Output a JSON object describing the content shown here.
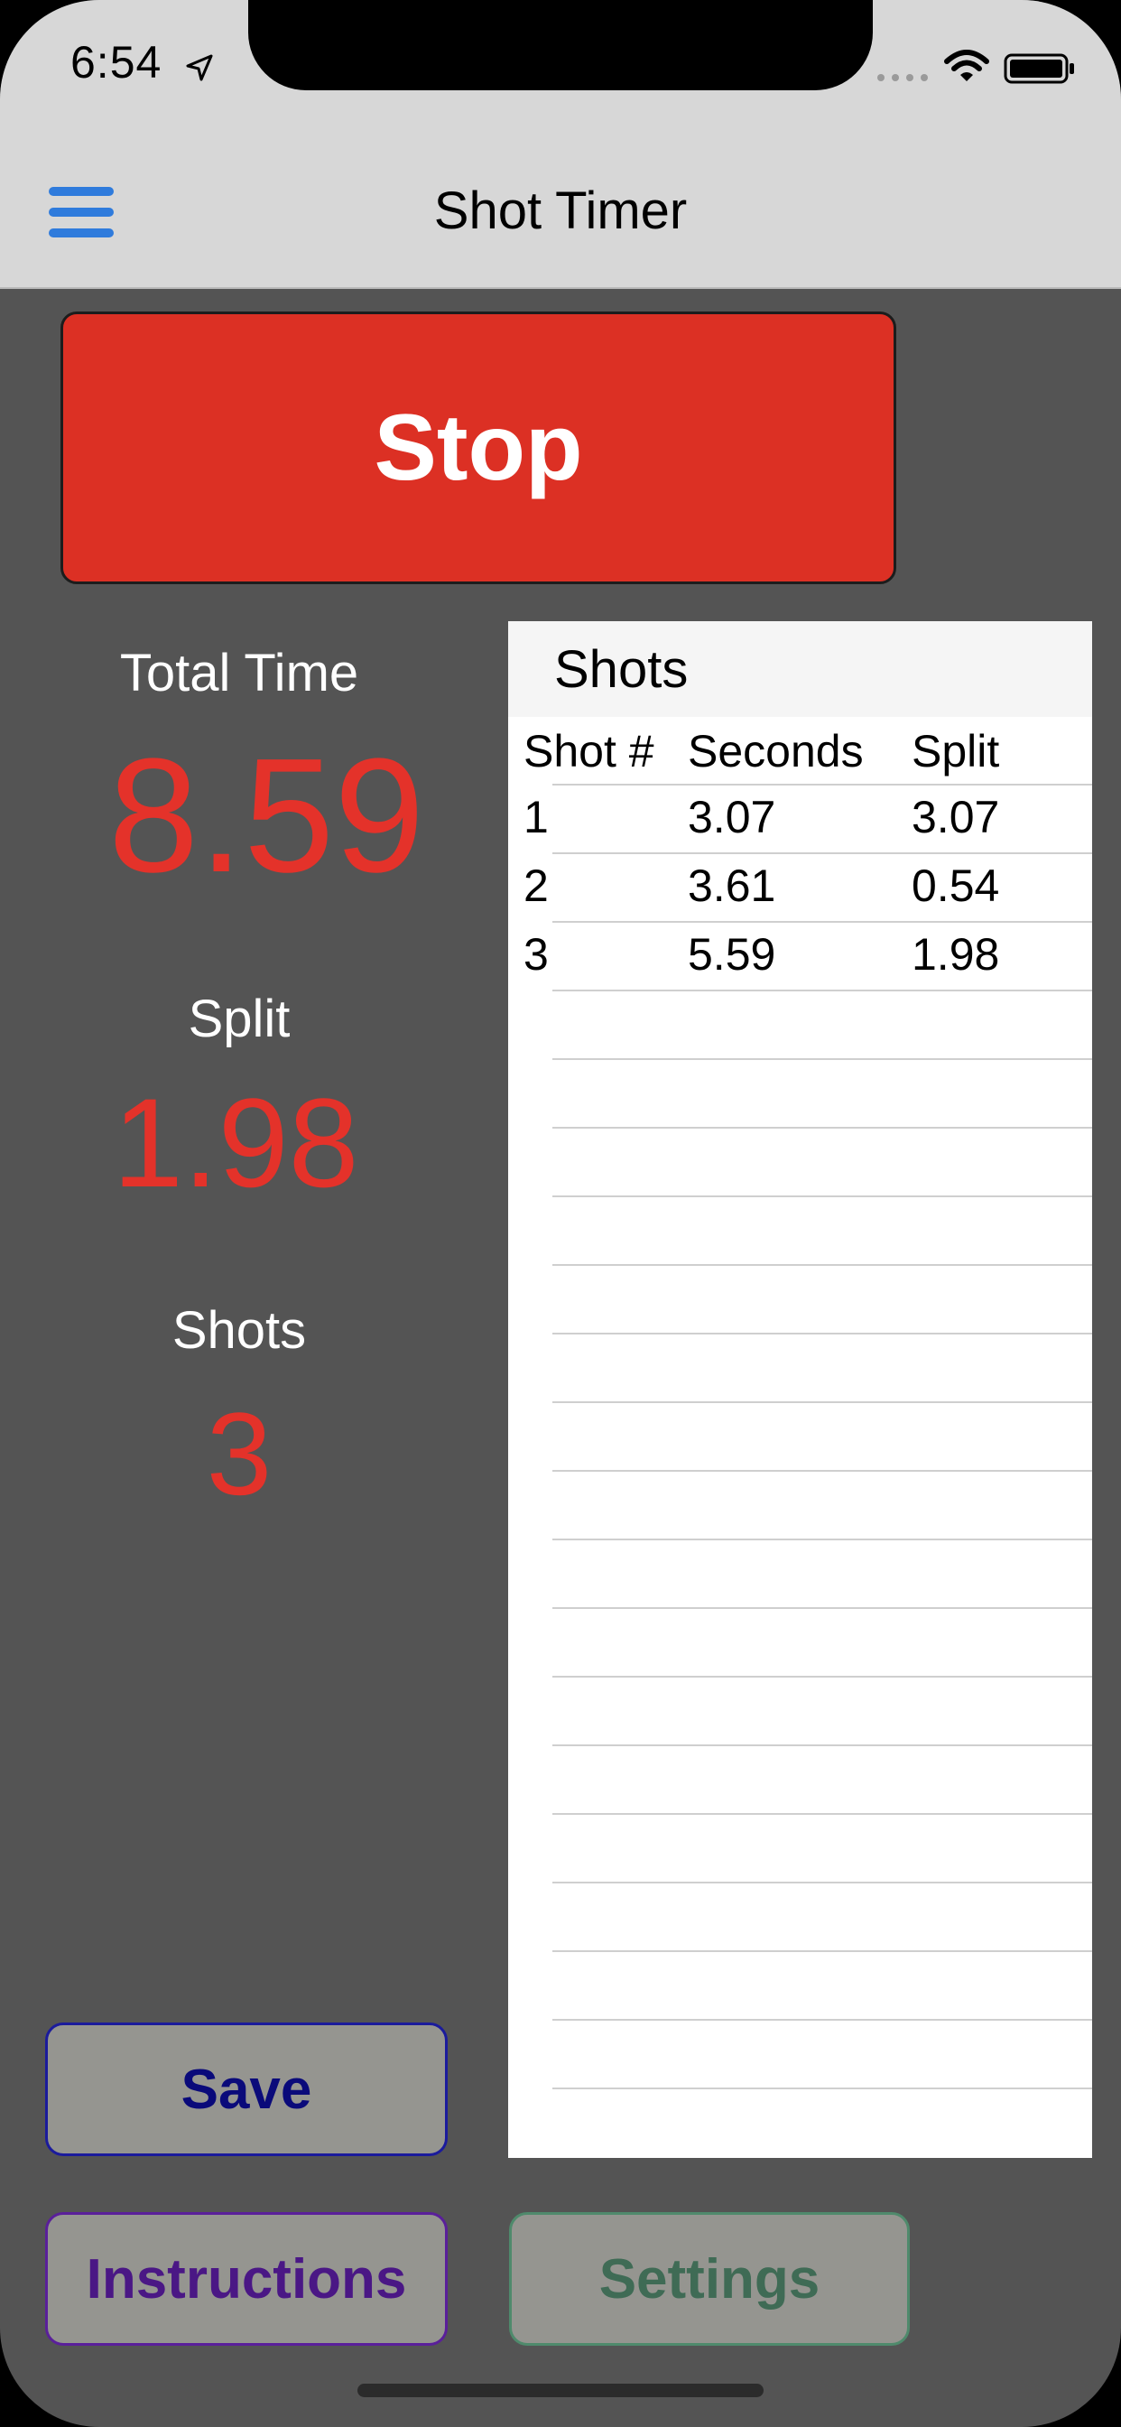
{
  "status_bar": {
    "time": "6:54"
  },
  "nav": {
    "title": "Shot Timer"
  },
  "timer": {
    "stop_label": "Stop"
  },
  "stats": {
    "total_time_label": "Total Time",
    "total_time_value": "8.59",
    "split_label": "Split",
    "split_value": "1.98",
    "shots_label": "Shots",
    "shots_value": "3"
  },
  "shots_table": {
    "title": "Shots",
    "columns": [
      "Shot #",
      "Seconds",
      "Split"
    ],
    "rows": [
      {
        "shot": "1",
        "seconds": "3.07",
        "split": "3.07"
      },
      {
        "shot": "2",
        "seconds": "3.61",
        "split": "0.54"
      },
      {
        "shot": "3",
        "seconds": "5.59",
        "split": "1.98"
      }
    ]
  },
  "buttons": {
    "save": "Save",
    "instructions": "Instructions",
    "settings": "Settings"
  },
  "colors": {
    "stop_button": "#dc3024",
    "stat_value": "#e4322a",
    "background": "#545454",
    "nav_icon": "#2f7bdc"
  },
  "icons": {
    "menu": "hamburger-menu-icon",
    "location": "location-arrow-icon",
    "signal": "cellular-signal-icon",
    "wifi": "wifi-icon",
    "battery": "battery-icon"
  }
}
